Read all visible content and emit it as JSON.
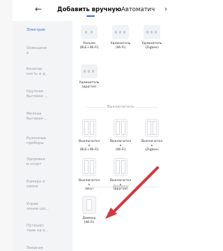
{
  "header": {
    "back_icon": "←",
    "tabs": [
      {
        "label": "Добавить вручную",
        "active": true
      },
      {
        "label": "Автоматич",
        "active": false
      }
    ],
    "more": "›"
  },
  "sidebar": {
    "items": [
      {
        "label": "Электрик",
        "active": true
      },
      {
        "label": "Освещени\nе",
        "active": false
      },
      {
        "label": "Безопас\nность и д...",
        "active": false
      },
      {
        "label": "Крупная\nбытовая ...",
        "active": false
      },
      {
        "label": "Мелкая\nбытовая ...",
        "active": false
      },
      {
        "label": "Кухонные\nприборы",
        "active": false
      },
      {
        "label": "Здоровье\nи спорт",
        "active": false
      },
      {
        "label": "Камера и\nзамок",
        "active": false
      },
      {
        "label": "Управ\nление шл...",
        "active": false
      },
      {
        "label": "Путешес\nтвие на о...",
        "active": false
      },
      {
        "label": "Энергия",
        "active": false
      }
    ]
  },
  "sockets": {
    "row1": [
      {
        "label": "Разъем\n(BLE+Wi-Fi)"
      },
      {
        "label": "Удлинитель\n(Wi-Fi)"
      },
      {
        "label": "Удлинитель\n(Zigbee)"
      }
    ],
    "row2": [
      {
        "label": "Удлинитель\n(другое)"
      }
    ]
  },
  "switches": {
    "title": "Выключатель",
    "row1": [
      {
        "label": "Выключател\nь\n(BLE+Wi-Fi)"
      },
      {
        "label": "Выключател\nь\n(Wi-Fi)"
      },
      {
        "label": "Выключател\nь\n(Zigbee)"
      }
    ],
    "row2": [
      {
        "label": "Выключател\nь\n(BLE)"
      },
      {
        "label": "Выключател\nь\n(другое)"
      }
    ]
  },
  "dimmer": {
    "title": "Диммер",
    "items": [
      {
        "label": "Диммер\n(Wi-Fi)"
      }
    ]
  },
  "colors": {
    "accent": "#3a6be0",
    "arrow": "#d8353b",
    "sidebar_bg": "#f3f4f6"
  }
}
